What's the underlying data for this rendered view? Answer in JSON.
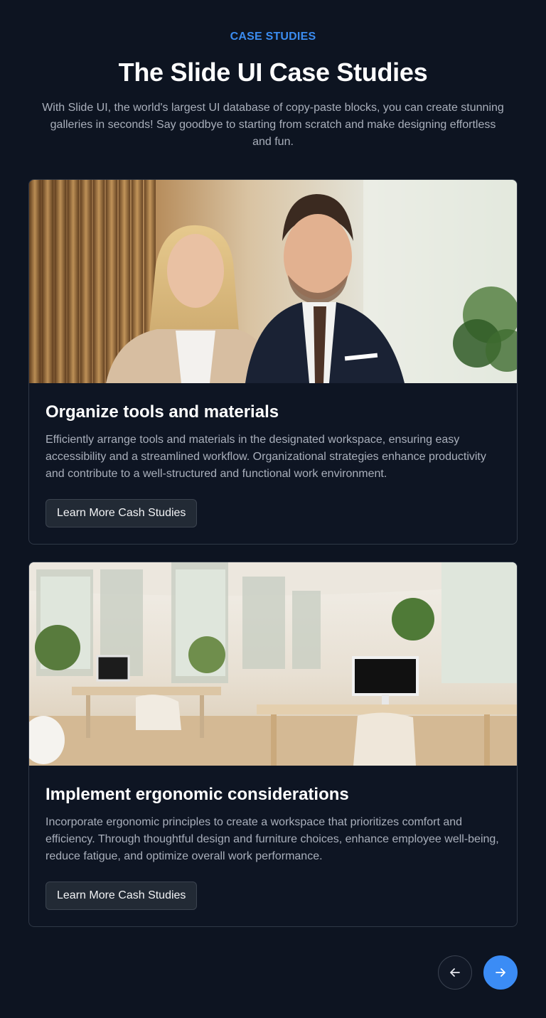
{
  "header": {
    "eyebrow": "CASE STUDIES",
    "title": "The Slide UI Case Studies",
    "subtitle": "With Slide UI, the world's largest UI database of copy-paste blocks, you can create stunning galleries in seconds! Say goodbye to starting from scratch and make designing effortless and fun."
  },
  "cards": [
    {
      "image": "business-people-photo",
      "title": "Organize tools and materials",
      "text": "Efficiently arrange tools and materials in the designated workspace, ensuring easy accessibility and a streamlined workflow. Organizational strategies enhance productivity and contribute to a well-structured and functional work environment.",
      "button_label": "Learn More Cash Studies"
    },
    {
      "image": "office-interior-photo",
      "title": "Implement ergonomic considerations",
      "text": "Incorporate ergonomic principles to create a workspace that prioritizes comfort and efficiency. Through thoughtful design and furniture choices, enhance employee well-being, reduce fatigue, and optimize overall work performance.",
      "button_label": "Learn More Cash Studies"
    }
  ],
  "navigation": {
    "prev_icon": "arrow-left-icon",
    "next_icon": "arrow-right-icon"
  },
  "colors": {
    "background": "#0d1421",
    "accent": "#3b8cf5",
    "card_border": "#2f3846",
    "muted_text": "#a9afbb"
  }
}
